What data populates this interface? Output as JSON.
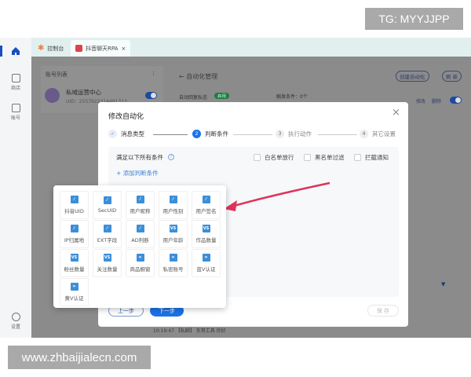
{
  "watermarks": {
    "top": "TG: MYYJJPP",
    "bottom": "www.zhbaijialecn.com"
  },
  "sidebar": {
    "items": [
      {
        "label": "",
        "icon": "home-icon"
      },
      {
        "label": "商店",
        "icon": "store-icon"
      },
      {
        "label": "账号",
        "icon": "account-icon"
      },
      {
        "label": "设置",
        "icon": "gear-icon"
      }
    ]
  },
  "tabs": [
    {
      "label": "控制台",
      "icon": "console-icon"
    },
    {
      "label": "抖音聊天RPA",
      "icon": "douyin-icon",
      "close": "×"
    }
  ],
  "account_panel": {
    "title": "账号列表",
    "more": "⋮",
    "account": {
      "name": "私域运营中心",
      "uid": "UID：2557922314491313"
    }
  },
  "automation": {
    "back": "←",
    "title": "自动化管理",
    "create": "创建自动化",
    "refresh": "刷 新",
    "rule_name": "自动回复私信",
    "rule_badge": "启用",
    "trigger": "触发条件：0个",
    "edit": "修改",
    "delete": "删除",
    "log": "10:19:47 【私聊】 东哥工具  你好"
  },
  "dialog": {
    "title": "修改自动化",
    "close": "×",
    "steps": [
      {
        "num": "✓",
        "label": "消息类型"
      },
      {
        "num": "2",
        "label": "判断条件"
      },
      {
        "num": "3",
        "label": "执行动作"
      },
      {
        "num": "4",
        "label": "其它设置"
      }
    ],
    "condition_label": "满足以下所有条件",
    "help": "?",
    "checkboxes": [
      "白名单放行",
      "黑名单过滤",
      "拦截通知"
    ],
    "add_condition": "添加判断条件",
    "add_icon": "+",
    "prev": "上一步",
    "next": "下一步",
    "save": "保 存"
  },
  "popup": {
    "items": [
      {
        "label": "抖音UID",
        "icon": "edit"
      },
      {
        "label": "SecUID",
        "icon": "edit"
      },
      {
        "label": "用户昵称",
        "icon": "edit"
      },
      {
        "label": "用户性别",
        "icon": "edit"
      },
      {
        "label": "用户签名",
        "icon": "edit"
      },
      {
        "label": "IP归属地",
        "icon": "edit"
      },
      {
        "label": "EXT字段",
        "icon": "edit"
      },
      {
        "label": "AD判断",
        "icon": "edit"
      },
      {
        "label": "用户年龄",
        "icon": "VS"
      },
      {
        "label": "作品数量",
        "icon": "VS"
      },
      {
        "label": "粉丝数量",
        "icon": "VS"
      },
      {
        "label": "关注数量",
        "icon": "VS"
      },
      {
        "label": "商品橱窗",
        "icon": "equals"
      },
      {
        "label": "私密账号",
        "icon": "equals"
      },
      {
        "label": "蓝V认证",
        "icon": "equals"
      },
      {
        "label": "黄V认证",
        "icon": "equals"
      }
    ]
  },
  "colors": {
    "primary": "#1a73e8",
    "arrow": "#e0325a",
    "badge": "#1f9e4a"
  }
}
